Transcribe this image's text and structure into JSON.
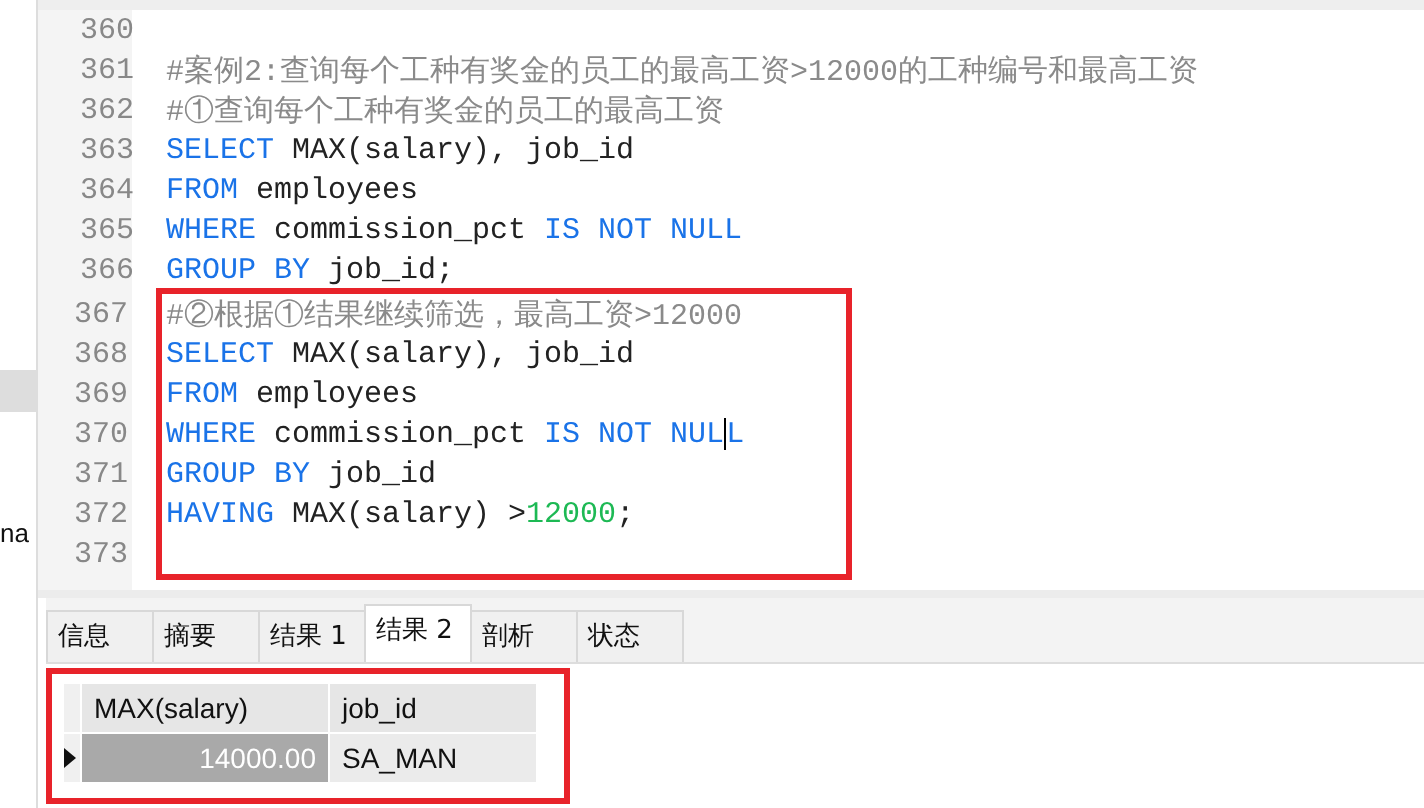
{
  "side_strip": {
    "label": "na"
  },
  "editor": {
    "blocks": [
      {
        "lines": [
          {
            "number": "360"
          },
          {
            "number": "361",
            "tokens": [
              {
                "kind": "comment",
                "text": "#案例2:查询每个工种有奖金的员工的最高工资>12000的工种编号和最高工资"
              }
            ]
          },
          {
            "number": "362",
            "tokens": [
              {
                "kind": "comment",
                "text": "#①查询每个工种有奖金的员工的最高工资"
              }
            ]
          },
          {
            "number": "363",
            "tokens": [
              {
                "kind": "keyword",
                "text": "SELECT"
              },
              {
                "kind": "plain",
                "text": " MAX(salary), job_id"
              }
            ]
          },
          {
            "number": "364",
            "tokens": [
              {
                "kind": "keyword",
                "text": "FROM"
              },
              {
                "kind": "plain",
                "text": " employees"
              }
            ]
          },
          {
            "number": "365",
            "tokens": [
              {
                "kind": "keyword",
                "text": "WHERE"
              },
              {
                "kind": "plain",
                "text": " commission_pct "
              },
              {
                "kind": "keyword",
                "text": "IS NOT NULL"
              }
            ]
          },
          {
            "number": "366",
            "tokens": [
              {
                "kind": "keyword",
                "text": "GROUP BY"
              },
              {
                "kind": "plain",
                "text": " job_id;"
              }
            ]
          }
        ]
      },
      {
        "highlighted": true,
        "lines": [
          {
            "number": "367",
            "tokens": [
              {
                "kind": "comment",
                "text": "#②根据①结果继续筛选，最高工资>12000"
              }
            ]
          },
          {
            "number": "368",
            "tokens": [
              {
                "kind": "keyword",
                "text": "SELECT"
              },
              {
                "kind": "plain",
                "text": " MAX(salary), job_id"
              }
            ]
          },
          {
            "number": "369",
            "tokens": [
              {
                "kind": "keyword",
                "text": "FROM"
              },
              {
                "kind": "plain",
                "text": " employees"
              }
            ]
          },
          {
            "number": "370",
            "tokens": [
              {
                "kind": "keyword",
                "text": "WHERE"
              },
              {
                "kind": "plain",
                "text": " commission_pct "
              },
              {
                "kind": "keyword",
                "text": "IS NOT NUL",
                "cursor_after": true
              },
              {
                "kind": "keyword",
                "text": "L"
              }
            ]
          },
          {
            "number": "371",
            "tokens": [
              {
                "kind": "keyword",
                "text": "GROUP BY"
              },
              {
                "kind": "plain",
                "text": " job_id"
              }
            ]
          },
          {
            "number": "372",
            "tokens": [
              {
                "kind": "keyword",
                "text": "HAVING"
              },
              {
                "kind": "plain",
                "text": " MAX(salary) >"
              },
              {
                "kind": "number",
                "text": "12000"
              },
              {
                "kind": "plain",
                "text": ";"
              }
            ]
          },
          {
            "number": "373"
          }
        ]
      }
    ]
  },
  "results": {
    "highlighted": true,
    "tabs": [
      {
        "label": "信息",
        "selected": false
      },
      {
        "label": "摘要",
        "selected": false
      },
      {
        "label": "结果 1",
        "selected": false
      },
      {
        "label": "结果 2",
        "selected": true
      },
      {
        "label": "剖析",
        "selected": false
      },
      {
        "label": "状态",
        "selected": false
      }
    ],
    "columns": [
      "MAX(salary)",
      "job_id"
    ],
    "rows": [
      {
        "selected": true,
        "cells": [
          "14000.00",
          "SA_MAN"
        ]
      }
    ]
  }
}
